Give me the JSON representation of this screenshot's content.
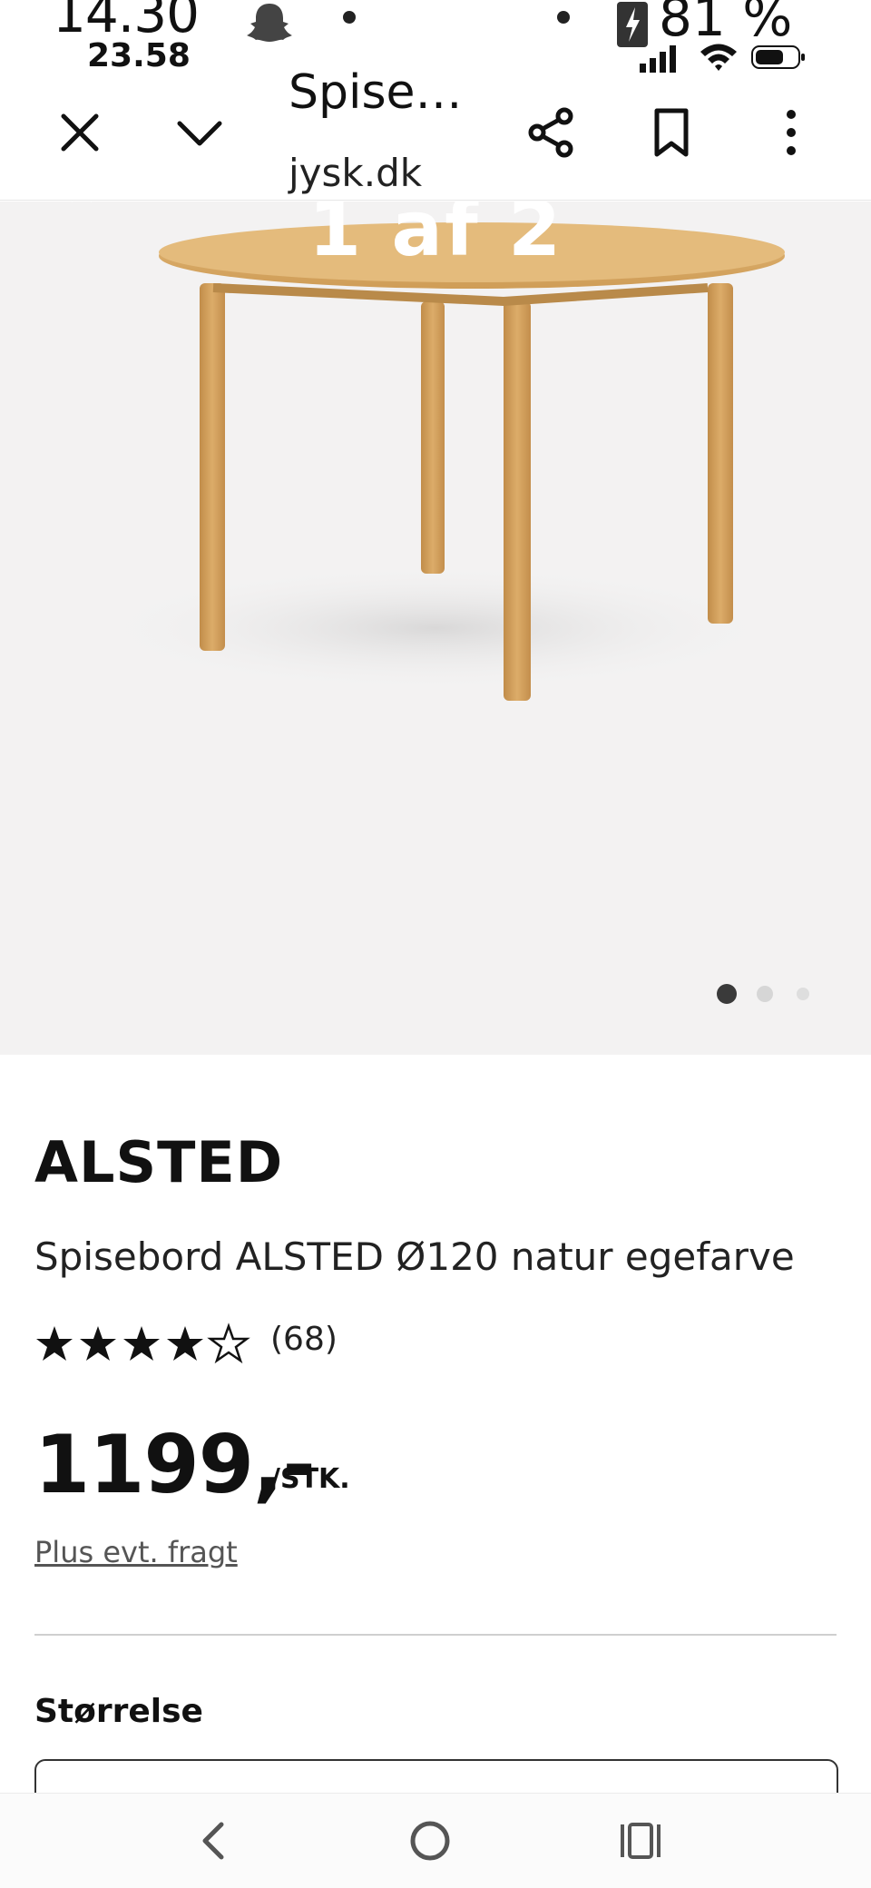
{
  "status_bar": {
    "time_primary": "14.30",
    "time_secondary": "23.58",
    "battery_percent": "81 %"
  },
  "browser": {
    "page_title": "Spise…",
    "page_url": "jysk.dk",
    "icons": [
      "close-icon",
      "chevron-down-icon",
      "share-icon",
      "bookmark-icon",
      "more-vert-icon"
    ]
  },
  "gallery": {
    "counter": "1 af 2",
    "pager_total": 3,
    "pager_active": 1
  },
  "product": {
    "brand": "ALSTED",
    "name": "Spisebord ALSTED Ø120 natur egefarve",
    "rating": 4.5,
    "reviews": "(68)",
    "price": "1199,-",
    "unit": "/STK.",
    "shipping": "Plus evt. fragt",
    "size_label": "Størrelse"
  },
  "colors": {
    "background": "#ffffff",
    "gallery_background": "#f3f2f2",
    "wood": "#d8a865",
    "text": "#111111"
  },
  "nav": {
    "icons": [
      "back-icon",
      "home-icon",
      "recents-icon"
    ]
  }
}
